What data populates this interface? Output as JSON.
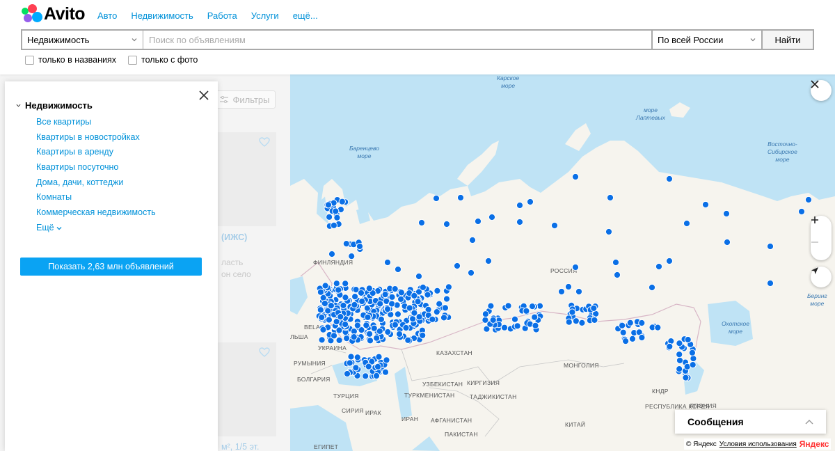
{
  "header": {
    "logo_text": "Avito",
    "nav": [
      "Авто",
      "Недвижимость",
      "Работа",
      "Услуги",
      "ещё..."
    ]
  },
  "search": {
    "category": "Недвижимость",
    "placeholder": "Поиск по объявлениям",
    "region": "По всей России",
    "find_label": "Найти"
  },
  "filters": {
    "only_titles": "только в названиях",
    "only_photo": "только с фото"
  },
  "panel": {
    "heading": "Недвижимость",
    "links": [
      "Все квартиры",
      "Квартиры в новостройках",
      "Квартиры в аренду",
      "Квартиры посуточно",
      "Дома, дачи, коттеджи",
      "Комнаты",
      "Коммерческая недвижимость"
    ],
    "more": "Ещё",
    "show_button": "Показать 2,63 млн объявлений"
  },
  "background_list": {
    "filters_label": "Фильтры",
    "ghost_title": "(ИЖС)",
    "ghost_line1": "ласть",
    "ghost_line2": "он село",
    "ghost_bottom": "м², 1/5 эт."
  },
  "map": {
    "countries": {
      "finland": "ФИНЛЯНДИЯ",
      "russia": "РОССИЯ",
      "belarus": "BELARUS",
      "ukraine": "УКРАИНА",
      "romania": "РУМЫНИЯ",
      "bulgaria": "БОЛГАРИЯ",
      "turkey": "ТУРЦИЯ",
      "kazakhstan": "КАЗАХСТАН",
      "mongolia": "МОНГОЛИЯ",
      "uzbekistan": "УЗБЕКИСТАН",
      "kyrgyzstan": "КИРГИЗИЯ",
      "turkmenistan": "ТУРКМЕНИСТАН",
      "tajikistan": "ТАДЖИКИСТАН",
      "syria": "СИРИЯ",
      "iraq": "ИРАК",
      "iran": "ИРАН",
      "afghanistan": "АФГАНИСТАН",
      "pakistan": "ПАКИСТАН",
      "china": "КИТАЙ",
      "japan": "ЯПОНИЯ",
      "south_korea": "РЕСПУБЛИКА КОРЕЯ",
      "north_korea": "КНДР",
      "egypt": "ЕГИПЕТ",
      "poland_partial": "ЛЬША"
    },
    "seas": {
      "kara": "Карское\nморе",
      "laptev": "море\nЛаптевых",
      "barents": "Баренцево\nморе",
      "east_siberian": "Восточно-\nСибирское\nморе",
      "okhotsk": "Охотское\nморе",
      "bering": "Беринг\nморе"
    },
    "messages_label": "Сообщения",
    "copyright_label": "© Яндекс",
    "terms_label": "Условия использования",
    "yandex_label": "Яндекс",
    "pin_color": "#0a6fe6"
  }
}
